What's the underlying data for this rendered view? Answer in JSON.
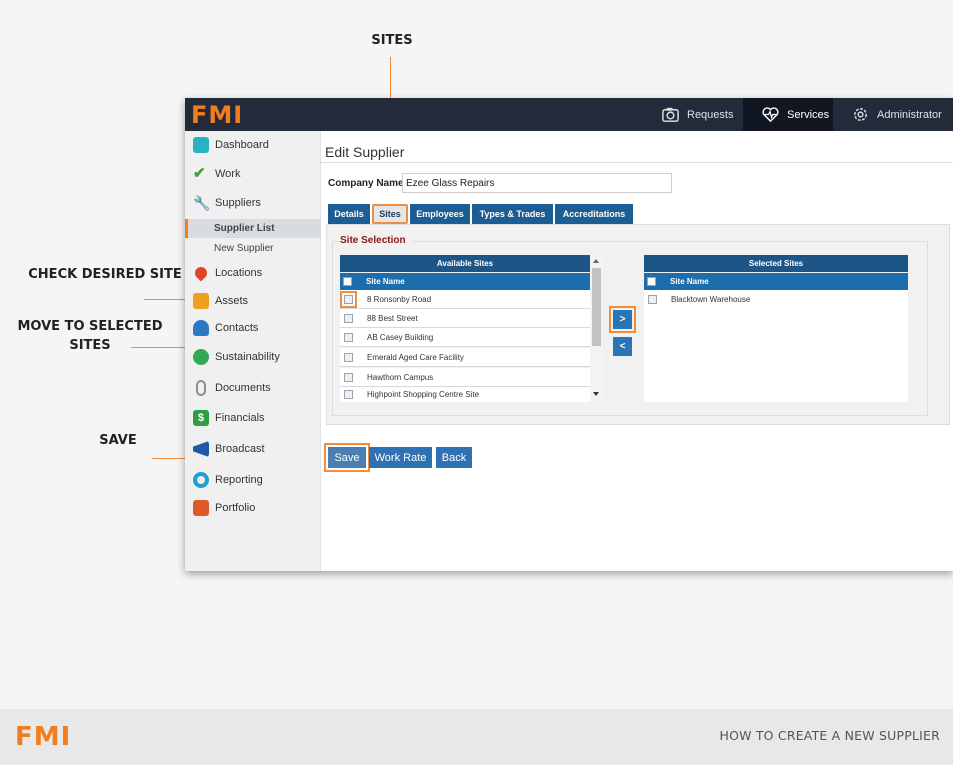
{
  "callouts": {
    "sites": "SITES",
    "check_site": "CHECK DESIRED SITE",
    "move_line1": "MOVE TO SELECTED",
    "move_line2": "SITES",
    "save": "SAVE"
  },
  "app": {
    "logo": "FMI",
    "topnav": [
      {
        "label": "Requests",
        "icon": "camera-icon"
      },
      {
        "label": "Services",
        "icon": "heart-pulse-icon"
      },
      {
        "label": "Administrator",
        "icon": "gear-icon"
      }
    ]
  },
  "sidebar": {
    "items": [
      {
        "label": "Dashboard",
        "icon": "dashboard-icon",
        "color": "#2ab1c4"
      },
      {
        "label": "Work",
        "icon": "check-icon",
        "color": "#3aa33a"
      },
      {
        "label": "Suppliers",
        "icon": "wrench-icon",
        "color": "#8c8c8c"
      },
      {
        "label": "Locations",
        "icon": "map-pin-icon",
        "color": "#e0452a"
      },
      {
        "label": "Assets",
        "icon": "box-icon",
        "color": "#f0a020"
      },
      {
        "label": "Contacts",
        "icon": "people-icon",
        "color": "#2a79c4"
      },
      {
        "label": "Sustainability",
        "icon": "bulb-icon",
        "color": "#32a852"
      },
      {
        "label": "Documents",
        "icon": "paperclip-icon",
        "color": "#8c8c8c"
      },
      {
        "label": "Financials",
        "icon": "dollar-icon",
        "color": "#2e9e45"
      },
      {
        "label": "Broadcast",
        "icon": "megaphone-icon",
        "color": "#1f5aa6"
      },
      {
        "label": "Reporting",
        "icon": "donut-icon",
        "color": "#1e9fd4"
      },
      {
        "label": "Portfolio",
        "icon": "briefcase-icon",
        "color": "#e05a28"
      }
    ],
    "sub_items": [
      "Supplier List",
      "New Supplier"
    ]
  },
  "main": {
    "title": "Edit Supplier",
    "company_label": "Company Name",
    "company_value": "Ezee Glass Repairs",
    "tabs": [
      "Details",
      "Sites",
      "Employees",
      "Types & Trades",
      "Accreditations"
    ],
    "site_selection_label": "Site Selection",
    "available": {
      "header": "Available Sites",
      "column": "Site Name",
      "rows": [
        "8 Ronsonby Road",
        "88 Best Street",
        "AB Casey Building",
        "Emerald Aged Care Facility",
        "Hawthorn Campus",
        "Highpoint Shopping Centre Site"
      ]
    },
    "selected": {
      "header": "Selected Sites",
      "column": "Site Name",
      "rows": [
        "Blacktown Warehouse"
      ]
    },
    "move_right": ">",
    "move_left": "<",
    "buttons": {
      "save": "Save",
      "work_rate": "Work Rate",
      "back": "Back"
    }
  },
  "footer": {
    "logo": "FMI",
    "text": "HOW TO CREATE A NEW SUPPLIER"
  }
}
